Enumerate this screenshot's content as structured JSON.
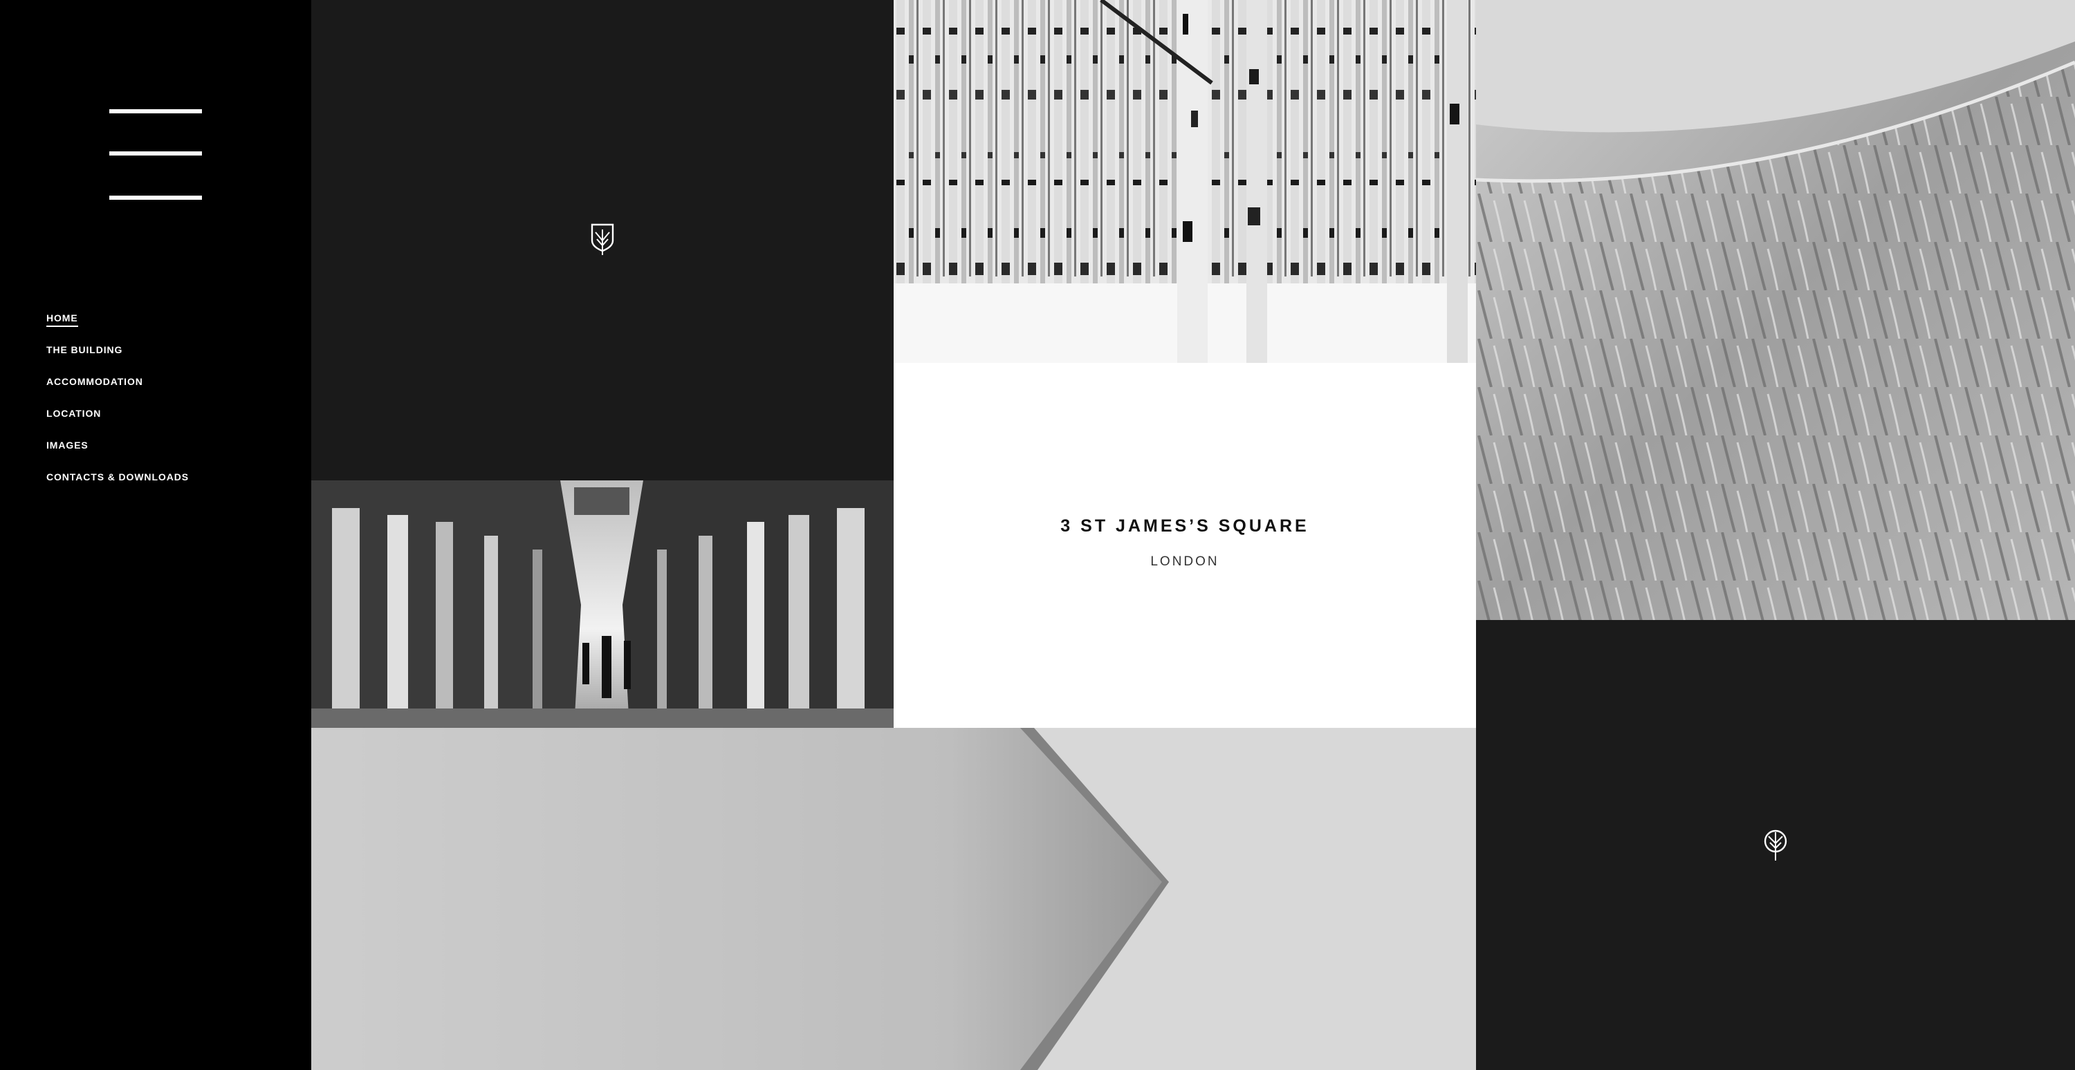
{
  "nav": {
    "menu_icon": "hamburger-menu-icon",
    "items": [
      {
        "label": "HOME",
        "active": true
      },
      {
        "label": "THE BUILDING",
        "active": false
      },
      {
        "label": "ACCOMMODATION",
        "active": false
      },
      {
        "label": "LOCATION",
        "active": false
      },
      {
        "label": "IMAGES",
        "active": false
      },
      {
        "label": "CONTACTS & DOWNLOADS",
        "active": false
      }
    ]
  },
  "hero": {
    "title": "3 ST JAMES’S SQUARE",
    "subtitle": "LONDON"
  },
  "tiles": {
    "dark_tile_icon": "shield-tree-logo-icon",
    "dark_tile_2_icon": "tree-logo-icon",
    "images": [
      "birch-forest-photo",
      "sand-dune-photo",
      "arcade-photo",
      "folded-paper-photo"
    ]
  },
  "colors": {
    "sidebar_bg": "#000000",
    "tile_dark": "#1a1a1a",
    "text_light": "#ffffff",
    "text_dark": "#111111"
  }
}
